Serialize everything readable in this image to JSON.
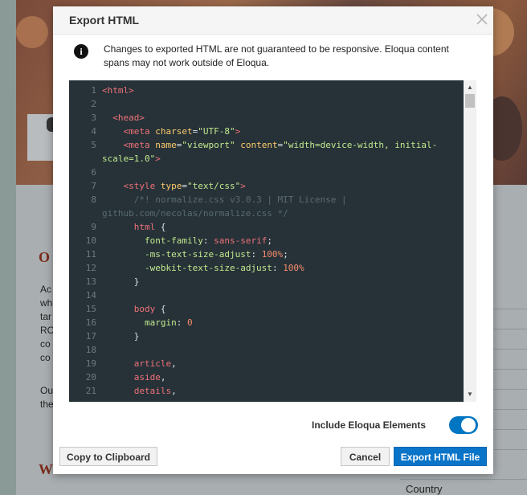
{
  "background": {
    "heading1": "O",
    "text_lines": [
      "Ac",
      "wh",
      "tar",
      "RO",
      "co",
      "co"
    ],
    "text_lines2": [
      "Ou",
      "the"
    ],
    "heading2": "W",
    "country_label": "Country"
  },
  "modal": {
    "title": "Export HTML",
    "info_text": "Changes to exported HTML are not guaranteed to be responsive. Eloqua content spans may not work outside of Eloqua.",
    "code_lines": [
      {
        "n": "1",
        "tokens": [
          [
            "tag",
            "<html>"
          ]
        ]
      },
      {
        "n": "2",
        "tokens": []
      },
      {
        "n": "3",
        "tokens": [
          [
            "plain",
            "  "
          ],
          [
            "tag",
            "<head>"
          ]
        ]
      },
      {
        "n": "4",
        "tokens": [
          [
            "plain",
            "    "
          ],
          [
            "tag",
            "<meta "
          ],
          [
            "attr",
            "charset"
          ],
          [
            "plain",
            "="
          ],
          [
            "str",
            "\"UTF-8\""
          ],
          [
            "tag",
            ">"
          ]
        ]
      },
      {
        "n": "5",
        "tokens": [
          [
            "plain",
            "    "
          ],
          [
            "tag",
            "<meta "
          ],
          [
            "attr",
            "name"
          ],
          [
            "plain",
            "="
          ],
          [
            "str",
            "\"viewport\""
          ],
          [
            "plain",
            " "
          ],
          [
            "attr",
            "content"
          ],
          [
            "plain",
            "="
          ],
          [
            "str",
            "\"width=device-width, initial-scale=1.0\""
          ],
          [
            "tag",
            ">"
          ]
        ]
      },
      {
        "n": "6",
        "tokens": []
      },
      {
        "n": "7",
        "tokens": [
          [
            "plain",
            "    "
          ],
          [
            "tag",
            "<style "
          ],
          [
            "attr",
            "type"
          ],
          [
            "plain",
            "="
          ],
          [
            "str",
            "\"text/css\""
          ],
          [
            "tag",
            ">"
          ]
        ]
      },
      {
        "n": "8",
        "tokens": [
          [
            "plain",
            "      "
          ],
          [
            "cmt",
            "/*! normalize.css v3.0.3 | MIT License | github.com/necolas/normalize.css */"
          ]
        ]
      },
      {
        "n": "9",
        "tokens": [
          [
            "plain",
            "      "
          ],
          [
            "tag",
            "html"
          ],
          [
            "plain",
            " {"
          ]
        ]
      },
      {
        "n": "10",
        "tokens": [
          [
            "plain",
            "        "
          ],
          [
            "str",
            "font-family"
          ],
          [
            "plain",
            ": "
          ],
          [
            "tag",
            "sans-serif"
          ],
          [
            "plain",
            ";"
          ]
        ]
      },
      {
        "n": "11",
        "tokens": [
          [
            "plain",
            "        "
          ],
          [
            "str",
            "-ms-text-size-adjust"
          ],
          [
            "plain",
            ": "
          ],
          [
            "num",
            "100%"
          ],
          [
            "plain",
            ";"
          ]
        ]
      },
      {
        "n": "12",
        "tokens": [
          [
            "plain",
            "        "
          ],
          [
            "str",
            "-webkit-text-size-adjust"
          ],
          [
            "plain",
            ": "
          ],
          [
            "num",
            "100%"
          ]
        ]
      },
      {
        "n": "13",
        "tokens": [
          [
            "plain",
            "      }"
          ]
        ]
      },
      {
        "n": "14",
        "tokens": []
      },
      {
        "n": "15",
        "tokens": [
          [
            "plain",
            "      "
          ],
          [
            "tag",
            "body"
          ],
          [
            "plain",
            " {"
          ]
        ]
      },
      {
        "n": "16",
        "tokens": [
          [
            "plain",
            "        "
          ],
          [
            "str",
            "margin"
          ],
          [
            "plain",
            ": "
          ],
          [
            "num",
            "0"
          ]
        ]
      },
      {
        "n": "17",
        "tokens": [
          [
            "plain",
            "      }"
          ]
        ]
      },
      {
        "n": "18",
        "tokens": []
      },
      {
        "n": "19",
        "tokens": [
          [
            "plain",
            "      "
          ],
          [
            "tag",
            "article"
          ],
          [
            "plain",
            ","
          ]
        ]
      },
      {
        "n": "20",
        "tokens": [
          [
            "plain",
            "      "
          ],
          [
            "tag",
            "aside"
          ],
          [
            "plain",
            ","
          ]
        ]
      },
      {
        "n": "21",
        "tokens": [
          [
            "plain",
            "      "
          ],
          [
            "tag",
            "details"
          ],
          [
            "plain",
            ","
          ]
        ]
      }
    ],
    "toggle_label": "Include Eloqua Elements",
    "toggle_on": true,
    "copy_button": "Copy to Clipboard",
    "cancel_button": "Cancel",
    "export_button": "Export HTML File",
    "colors": {
      "accent": "#0a74c8",
      "editor_bg": "#263238",
      "toggle_on": "#0075c2"
    }
  }
}
